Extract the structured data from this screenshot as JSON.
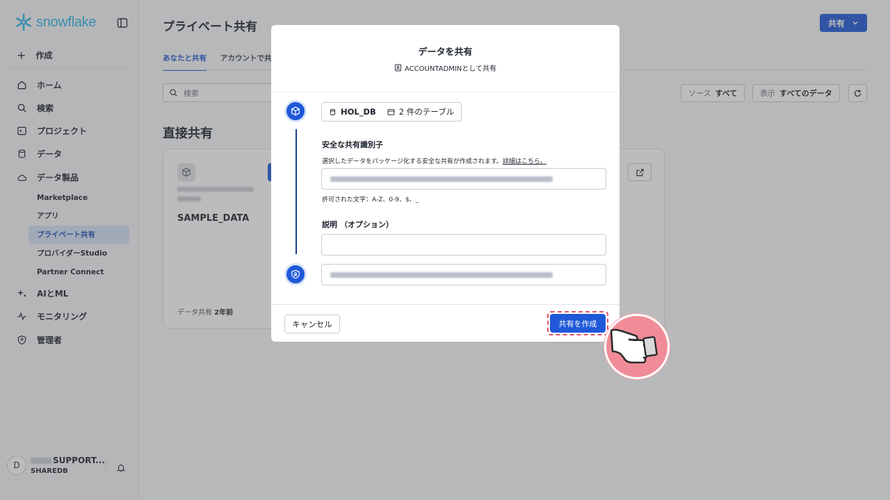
{
  "app": {
    "logo_text": "snowflake"
  },
  "sidebar": {
    "create_label": "作成",
    "items": [
      {
        "label": "ホーム"
      },
      {
        "label": "検索"
      },
      {
        "label": "プロジェクト"
      },
      {
        "label": "データ"
      },
      {
        "label": "データ製品"
      }
    ],
    "sub_items": [
      {
        "label": "Marketplace"
      },
      {
        "label": "アプリ"
      },
      {
        "label": "プライベート共有"
      },
      {
        "label": "プロバイダーStudio"
      },
      {
        "label": "Partner Connect"
      }
    ],
    "items_bottom": [
      {
        "label": "AIとML"
      },
      {
        "label": "モニタリング"
      },
      {
        "label": "管理者"
      }
    ],
    "user": {
      "initial": "D",
      "name_suffix": "SUPPORT...",
      "role": "SHAREDB"
    }
  },
  "main": {
    "title": "プライベート共有",
    "share_button": "共有",
    "tabs": [
      {
        "label": "あなたと共有"
      },
      {
        "label": "アカウントで共有"
      }
    ],
    "search_placeholder": "検索",
    "filters": [
      {
        "label": "ソース",
        "value": "すべて"
      },
      {
        "label": "表示",
        "value": "すべてのデータ"
      }
    ],
    "section_title": "直接共有",
    "card": {
      "title": "SAMPLE_DATA",
      "footer_label": "データ共有",
      "footer_value": "2年前"
    }
  },
  "modal": {
    "title": "データを共有",
    "subtitle": "ACCOUNTADMINとして共有",
    "db_name": "HOL_DB",
    "table_count": "2 件のテーブル",
    "identifier_label": "安全な共有識別子",
    "identifier_help": "選択したデータをパッケージ化する安全な共有が作成されます。",
    "identifier_help_link": "詳細はこちら。",
    "allowed_chars": "許可された文字：A-Z、0-9、$、_",
    "description_label": "説明 （オプション）",
    "cancel_button": "キャンセル",
    "create_button": "共有を作成"
  },
  "colors": {
    "accent": "#1f58d8",
    "logo": "#29b5e8",
    "highlight": "#e0526b",
    "pointer": "#f08c97"
  }
}
